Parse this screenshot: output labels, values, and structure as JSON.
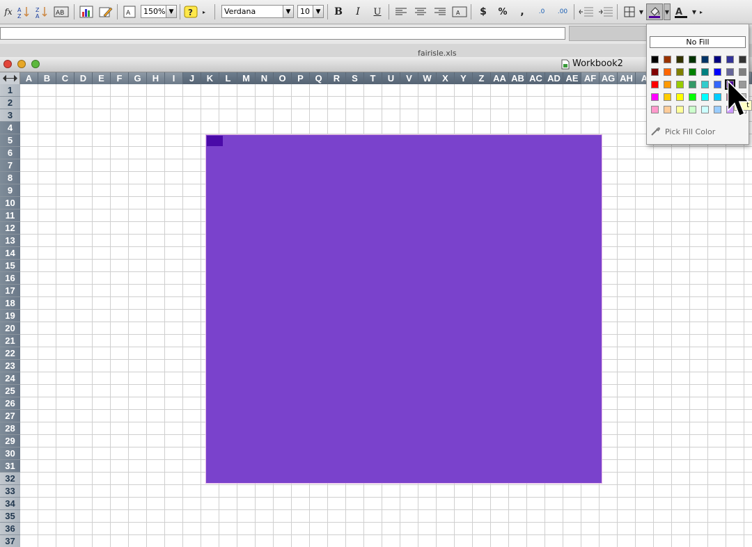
{
  "toolbar": {
    "fx_label": "fx",
    "zoom_value": "150%",
    "font_name": "Verdana",
    "font_size": "10",
    "bold_label": "B",
    "italic_label": "I",
    "underline_label": "U",
    "currency_label": "$",
    "percent_label": "%",
    "comma_label": ",",
    "increase_decimal_label": ".0",
    "decrease_decimal_label": ".00"
  },
  "tabstrip": {
    "file_tab": "fairisle.xls"
  },
  "window": {
    "title": "Workbook2"
  },
  "columns": [
    "A",
    "B",
    "C",
    "D",
    "E",
    "F",
    "G",
    "H",
    "I",
    "J",
    "K",
    "L",
    "M",
    "N",
    "O",
    "P",
    "Q",
    "R",
    "S",
    "T",
    "U",
    "V",
    "W",
    "X",
    "Y",
    "Z",
    "AA",
    "AB",
    "AC",
    "AD",
    "AE",
    "AF",
    "AG",
    "AH",
    "A"
  ],
  "rows": [
    "1",
    "2",
    "3",
    "4",
    "5",
    "6",
    "7",
    "8",
    "9",
    "10",
    "11",
    "12",
    "13",
    "14",
    "15",
    "16",
    "17",
    "18",
    "19",
    "20",
    "21",
    "22",
    "23",
    "24",
    "25",
    "26",
    "27",
    "28",
    "29",
    "30",
    "31",
    "32",
    "33",
    "34",
    "35",
    "36",
    "37"
  ],
  "selection": {
    "fill_color": "#7a42cc",
    "active_cell_color": "#4a0aa8",
    "start_col": "J",
    "end_col": "AE",
    "start_row": "4",
    "end_row": "31"
  },
  "fill_popup": {
    "no_fill_label": "No Fill",
    "pick_label": "Pick Fill Color",
    "tooltip_fragment": "t",
    "palette": [
      [
        "#000000",
        "#993300",
        "#333300",
        "#003300",
        "#003366",
        "#000080",
        "#333399",
        "#333333"
      ],
      [
        "#800000",
        "#ff6600",
        "#808000",
        "#008000",
        "#008080",
        "#0000ff",
        "#666699",
        "#808080"
      ],
      [
        "#ff0000",
        "#ff9900",
        "#99cc00",
        "#339966",
        "#33cccc",
        "#3366ff",
        "#4b0099",
        "#999999"
      ],
      [
        "#ff00ff",
        "#ffcc00",
        "#ffff00",
        "#00ff00",
        "#00ffff",
        "#00ccff",
        "#993366",
        "#c0c0c0"
      ],
      [
        "#ff99cc",
        "#ffcc99",
        "#ffff99",
        "#ccffcc",
        "#ccffff",
        "#99ccff",
        "#cc99ff",
        "#ffffff"
      ]
    ],
    "selected_swatch": "r2c6"
  }
}
